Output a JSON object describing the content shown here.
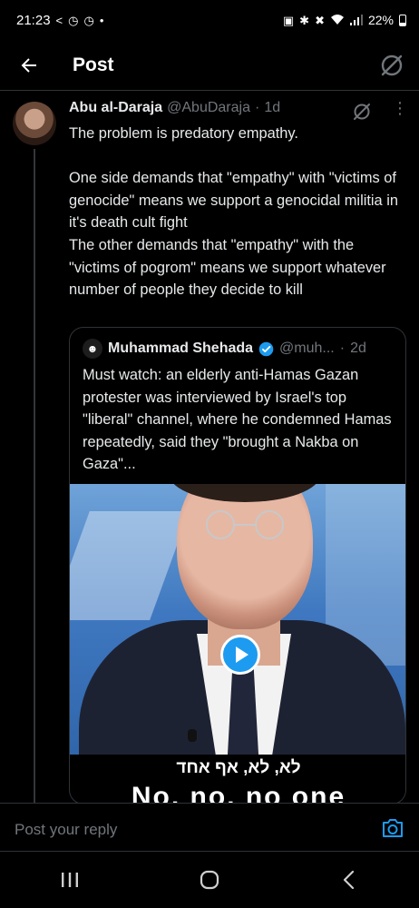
{
  "status_bar": {
    "time": "21:23",
    "battery": "22%",
    "left_icons": [
      "share-icon",
      "clock-icon",
      "clock-icon",
      "dot-icon"
    ],
    "right_icons": [
      "nfc-icon",
      "bluetooth-icon",
      "mute-icon",
      "wifi-icon",
      "signal-icon",
      "battery-icon"
    ]
  },
  "header": {
    "title": "Post"
  },
  "tweet": {
    "author_name": "Abu al-Daraja",
    "author_handle": "@AbuDaraja",
    "separator": "·",
    "time": "1d",
    "text": "The problem is predatory empathy.\n\nOne side demands that \"empathy\" with \"victims of genocide\" means we support a genocidal militia in it's death cult fight\nThe other demands that \"empathy\" with the \"victims of pogrom\" means we support whatever number of people they decide to kill"
  },
  "quote": {
    "author_name": "Muhammad Shehada",
    "author_handle": "@muh...",
    "separator": "·",
    "time": "2d",
    "text": "Must watch: an elderly anti-Hamas Gazan protester was interviewed by Israel's top \"liberal\" channel, where he condemned Hamas repeatedly, said they \"brought a Nakba on Gaza\"...",
    "video": {
      "subtitle_hebrew": "לא, לא, אף אחד",
      "subtitle_english": "No, no, no one"
    }
  },
  "reply": {
    "placeholder": "Post your reply"
  },
  "colors": {
    "background": "#000000",
    "text": "#e7e9ea",
    "muted": "#71767b",
    "accent": "#1d9bf0",
    "border": "#2f3336"
  }
}
